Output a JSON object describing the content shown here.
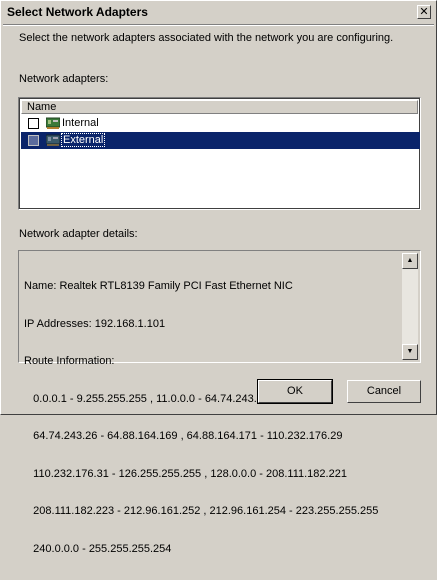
{
  "dialog": {
    "title": "Select Network Adapters",
    "close_glyph": "✕",
    "instructions": "Select the network adapters associated with the network you are configuring.",
    "adapters_label": "Network adapters:",
    "column_header": "Name",
    "adapters": [
      {
        "label": "Internal",
        "checked": false,
        "selected": false
      },
      {
        "label": "External",
        "checked": false,
        "selected": true
      }
    ],
    "details_label": "Network adapter details:",
    "details_lines": [
      "Name: Realtek RTL8139 Family PCI Fast Ethernet NIC",
      "IP Addresses: 192.168.1.101",
      "Route Information:",
      "   0.0.0.1 - 9.255.255.255 , 11.0.0.0 - 64.74.243.24",
      "   64.74.243.26 - 64.88.164.169 , 64.88.164.171 - 110.232.176.29",
      "   110.232.176.31 - 126.255.255.255 , 128.0.0.0 - 208.111.182.221",
      "   208.111.182.223 - 212.96.161.252 , 212.96.161.254 - 223.255.255.255",
      "   240.0.0.0 - 255.255.255.254"
    ],
    "scroll_up_glyph": "▲",
    "scroll_down_glyph": "▼",
    "ok_label": "OK",
    "cancel_label": "Cancel"
  },
  "icons": {
    "adapter": "network-adapter-icon"
  },
  "colors": {
    "face": "#d4d0c8",
    "selection": "#0a246a"
  }
}
